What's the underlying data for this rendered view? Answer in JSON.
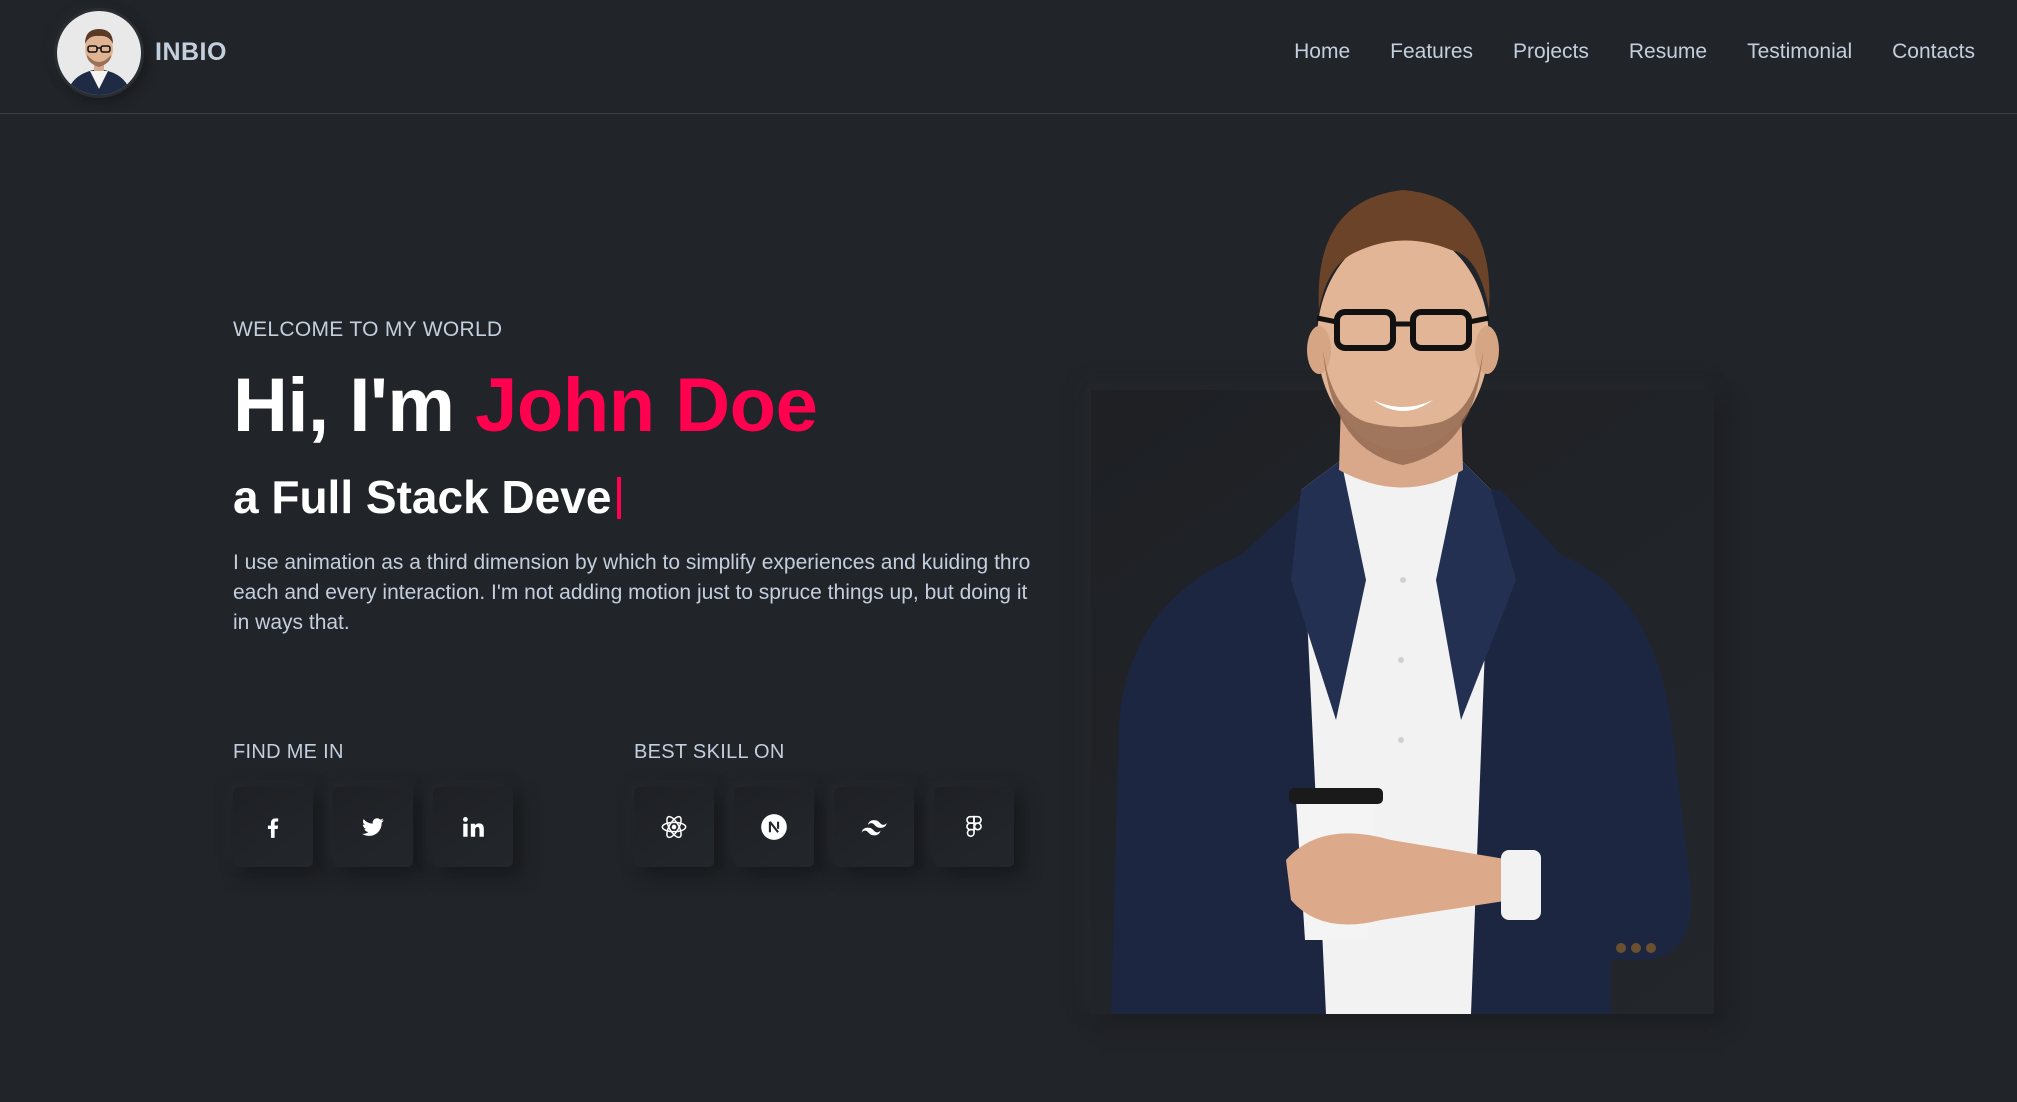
{
  "header": {
    "logo_text": "INBIO",
    "nav": [
      "Home",
      "Features",
      "Projects",
      "Resume",
      "Testimonial",
      "Contacts"
    ]
  },
  "hero": {
    "welcome": "WELCOME TO MY WORLD",
    "greeting": "Hi, I'm ",
    "name": "John Doe",
    "role": "a Full Stack Deve",
    "description": "I use animation as a third dimension by which to simplify experiences and kuiding thro each and every interaction. I'm not adding motion just to spruce things up, but doing it in ways that."
  },
  "find_me": {
    "label": "FIND ME IN",
    "icons": [
      "facebook-icon",
      "twitter-icon",
      "linkedin-icon"
    ]
  },
  "skills": {
    "label": "BEST SKILL ON",
    "icons": [
      "react-icon",
      "nextjs-icon",
      "tailwind-icon",
      "figma-icon"
    ]
  },
  "colors": {
    "background": "#212428",
    "accent": "#ff014f",
    "text": "#c4cfde",
    "heading": "#ffffff"
  }
}
